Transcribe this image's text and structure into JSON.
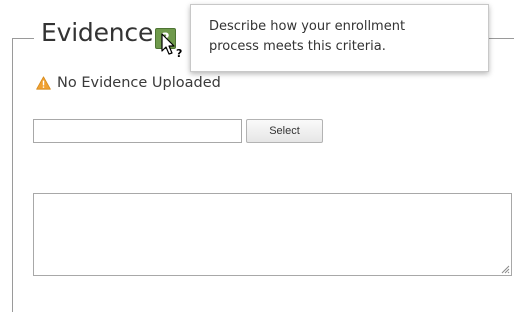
{
  "section": {
    "title": "Evidence"
  },
  "help": {
    "glyph": "?",
    "icon": "question-mark-icon",
    "color": "#6f9a4c"
  },
  "tooltip": {
    "line1": "Describe how your enrollment",
    "line2": "process meets this criteria."
  },
  "status": {
    "icon": "warning-triangle-icon",
    "icon_color": "#f0a030",
    "text": "No Evidence Uploaded"
  },
  "upload": {
    "filename_value": "",
    "select_label": "Select"
  },
  "description": {
    "value": ""
  }
}
